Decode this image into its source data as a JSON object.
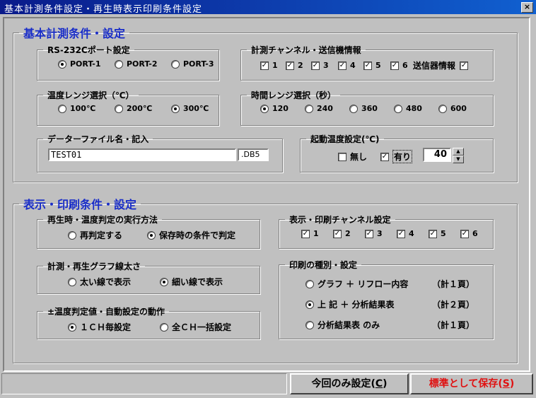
{
  "window": {
    "title": "基本計測条件設定・再生時表示印刷条件設定",
    "close": "×"
  },
  "section1": {
    "title": "基本計測条件・設定"
  },
  "rs232": {
    "title": "RS-232Cポート設定",
    "options": [
      {
        "label": "PORT-1",
        "selected": true
      },
      {
        "label": "PORT-2",
        "selected": false
      },
      {
        "label": "PORT-3",
        "selected": false
      }
    ]
  },
  "channels": {
    "title": "計測チャンネル・送信機情報",
    "items": [
      {
        "label": "1",
        "checked": true
      },
      {
        "label": "2",
        "checked": true
      },
      {
        "label": "3",
        "checked": true
      },
      {
        "label": "4",
        "checked": true
      },
      {
        "label": "5",
        "checked": true
      },
      {
        "label": "6",
        "checked": true
      }
    ],
    "transmitter_label": "送信器情報",
    "transmitter_checked": true
  },
  "temp_range": {
    "title": "温度レンジ選択（℃）",
    "options": [
      {
        "label": "100℃",
        "selected": false
      },
      {
        "label": "200℃",
        "selected": false
      },
      {
        "label": "300℃",
        "selected": true
      }
    ]
  },
  "time_range": {
    "title": "時間レンジ選択（秒）",
    "options": [
      {
        "label": "120",
        "selected": true
      },
      {
        "label": "240",
        "selected": false
      },
      {
        "label": "360",
        "selected": false
      },
      {
        "label": "480",
        "selected": false
      },
      {
        "label": "600",
        "selected": false
      }
    ]
  },
  "datafile": {
    "title": "データーファイル名・記入",
    "value": "TEST01",
    "ext": ".DB5"
  },
  "start_temp": {
    "title": "起動温度設定(℃)",
    "none_label": "無し",
    "none_checked": false,
    "yes_label": "有り",
    "yes_checked": true,
    "value": "40"
  },
  "section2": {
    "title": "表示・印刷条件・設定"
  },
  "replay": {
    "title": "再生時・温度判定の実行方法",
    "options": [
      {
        "label": "再判定する",
        "selected": false
      },
      {
        "label": "保存時の条件で判定",
        "selected": true
      }
    ]
  },
  "disp_channels": {
    "title": "表示・印刷チャンネル設定",
    "items": [
      {
        "label": "1",
        "checked": true
      },
      {
        "label": "2",
        "checked": true
      },
      {
        "label": "3",
        "checked": true
      },
      {
        "label": "4",
        "checked": true
      },
      {
        "label": "5",
        "checked": true
      },
      {
        "label": "6",
        "checked": true
      }
    ]
  },
  "line_width": {
    "title": "計測・再生グラフ線太さ",
    "options": [
      {
        "label": "太い線で表示",
        "selected": false
      },
      {
        "label": "細い線で表示",
        "selected": true
      }
    ]
  },
  "auto_set": {
    "title": "±温度判定値・自動設定の動作",
    "options": [
      {
        "label": "１ＣＨ毎設定",
        "selected": true
      },
      {
        "label": "全ＣＨ一括設定",
        "selected": false
      }
    ]
  },
  "print_type": {
    "title": "印刷の種別・設定",
    "options": [
      {
        "label": "グラフ ＋ リフロー内容",
        "pages": "（計１頁）",
        "selected": false
      },
      {
        "label": "上 記 ＋ 分析結果表",
        "pages": "（計２頁）",
        "selected": true
      },
      {
        "label": "分析結果表 のみ",
        "pages": "（計１頁）",
        "selected": false
      }
    ]
  },
  "buttons": {
    "once": {
      "text": "今回のみ設定(",
      "key": "C",
      "end": ")"
    },
    "save": {
      "text": "標準として保存(",
      "key": "S",
      "end": ")",
      "color": "#e01010"
    }
  }
}
